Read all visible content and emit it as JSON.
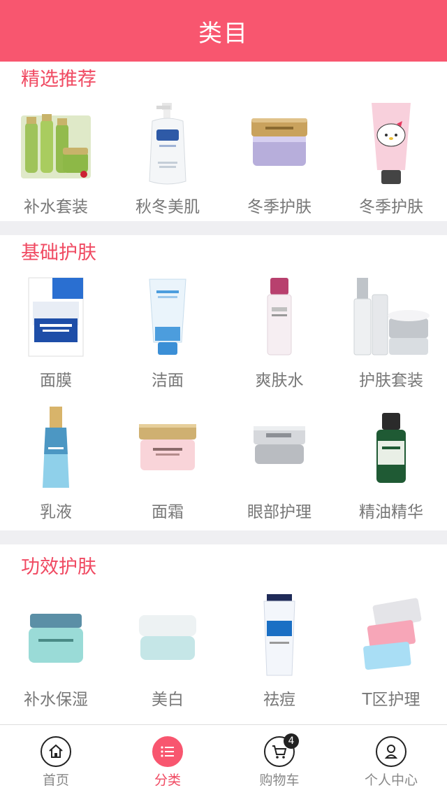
{
  "header": {
    "title": "类目"
  },
  "sections": [
    {
      "title": "精选推荐",
      "items": [
        {
          "label": "补水套装",
          "icon": "green-skincare-set-image"
        },
        {
          "label": "秋冬美肌",
          "icon": "pump-bottle-image"
        },
        {
          "label": "冬季护肤",
          "icon": "cream-jar-image"
        },
        {
          "label": "冬季护肤",
          "icon": "hand-cream-tube-image"
        }
      ]
    },
    {
      "title": "基础护肤",
      "items": [
        {
          "label": "面膜",
          "icon": "face-mask-image"
        },
        {
          "label": "洁面",
          "icon": "cleanser-tube-image"
        },
        {
          "label": "爽肤水",
          "icon": "toner-bottle-image"
        },
        {
          "label": "护肤套装",
          "icon": "skincare-set-image"
        },
        {
          "label": "乳液",
          "icon": "lotion-bottle-image"
        },
        {
          "label": "面霜",
          "icon": "face-cream-jar-image"
        },
        {
          "label": "眼部护理",
          "icon": "eye-cream-jar-image"
        },
        {
          "label": "精油精华",
          "icon": "essential-oil-bottle-image"
        }
      ]
    },
    {
      "title": "功效护肤",
      "items": [
        {
          "label": "补水保湿",
          "icon": "moisturizer-jar-image"
        },
        {
          "label": "美白",
          "icon": "whitening-cream-jar-image"
        },
        {
          "label": "祛痘",
          "icon": "acne-tube-image"
        },
        {
          "label": "T区护理",
          "icon": "nose-strips-image"
        }
      ]
    }
  ],
  "tabbar": {
    "tabs": [
      {
        "label": "首页",
        "icon": "home-icon"
      },
      {
        "label": "分类",
        "icon": "list-icon"
      },
      {
        "label": "购物车",
        "icon": "cart-icon",
        "badge": "4"
      },
      {
        "label": "个人中心",
        "icon": "user-icon"
      }
    ]
  },
  "colors": {
    "accent": "#f8566f",
    "section_title": "#f04a62",
    "gap": "#efeff2"
  }
}
